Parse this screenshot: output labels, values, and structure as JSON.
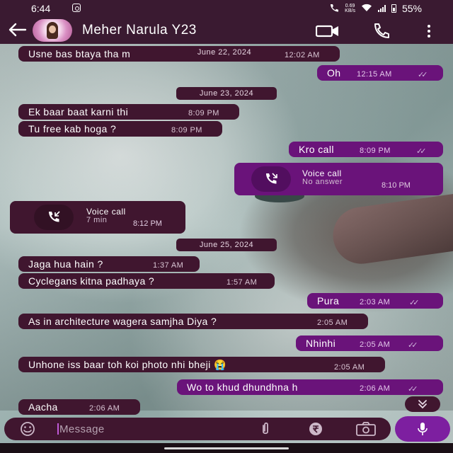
{
  "status_bar": {
    "time": "6:44",
    "speed_value": "0.69",
    "speed_unit": "KB/s",
    "battery": "55%"
  },
  "header": {
    "contact_name": "Meher Narula Y23"
  },
  "colors": {
    "bar_bg": "#3a1a31",
    "incoming_bubble": "#40162f",
    "outgoing_bubble": "#6a137a",
    "mic_button": "#7d1fa0"
  },
  "messages": [
    {
      "direction": "in",
      "text": "Usne bas btaya tha m",
      "time": "12:02 AM"
    },
    {
      "direction": "out",
      "text": "Oh",
      "time": "12:15 AM"
    },
    {
      "direction": "in",
      "text": "Ek baar baat karni thi",
      "time": "8:09 PM"
    },
    {
      "direction": "in",
      "text": "Tu free kab hoga ?",
      "time": "8:09 PM"
    },
    {
      "direction": "out",
      "text": "Kro call",
      "time": "8:09 PM"
    },
    {
      "direction": "in",
      "text": "Jaga hua hain ?",
      "time": "1:37 AM"
    },
    {
      "direction": "in",
      "text": "Cyclegans kitna padhaya ?",
      "time": "1:57 AM"
    },
    {
      "direction": "out",
      "text": "Pura",
      "time": "2:03 AM"
    },
    {
      "direction": "in",
      "text": "As in architecture wagera samjha Diya ?",
      "time": "2:05 AM"
    },
    {
      "direction": "out",
      "text": "Nhinhi",
      "time": "2:05 AM"
    },
    {
      "direction": "in",
      "text": "Unhone iss baar toh koi photo nhi bheji 😭",
      "time": "2:05 AM"
    },
    {
      "direction": "out",
      "text": "Wo to khud dhundhna h",
      "time": "2:06 AM"
    },
    {
      "direction": "in",
      "text": "Aacha",
      "time": "2:06 AM"
    }
  ],
  "dates": {
    "overlay": "June 22, 2024",
    "d1": "June 23, 2024",
    "d2": "June 25, 2024"
  },
  "calls": [
    {
      "direction": "out",
      "title": "Voice call",
      "sub": "No answer",
      "time": "8:10 PM"
    },
    {
      "direction": "in",
      "title": "Voice call",
      "sub": "7 min",
      "time": "8:12 PM"
    }
  ],
  "composer": {
    "placeholder": "Message"
  }
}
